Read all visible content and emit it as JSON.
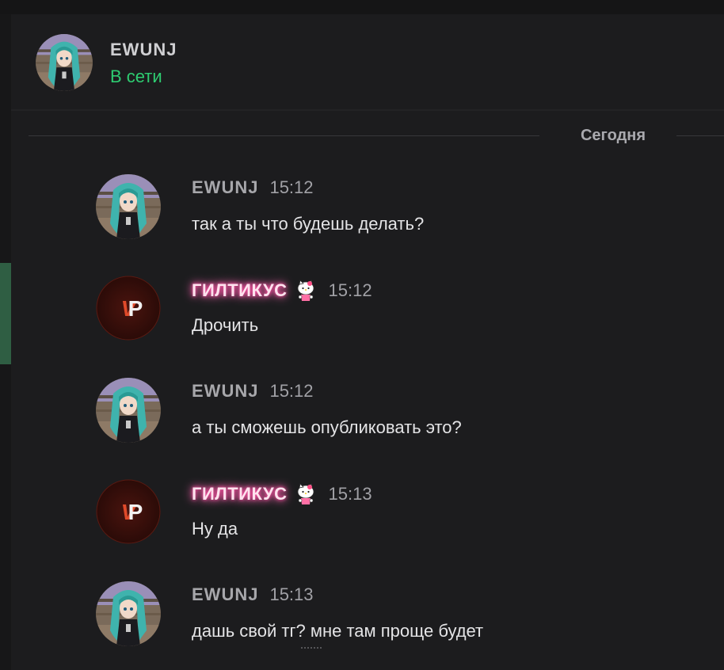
{
  "header": {
    "name": "EWUNJ",
    "status": "В сети"
  },
  "divider": {
    "label": "Сегодня"
  },
  "messages": [
    {
      "author": "EWUNJ",
      "time": "15:12",
      "text": "так а ты что будешь делать?",
      "avatar": "anime-avatar",
      "styled": false
    },
    {
      "author": "ГИЛТИКУС",
      "time": "15:12",
      "text": "Дрочить",
      "avatar": "vp-logo-avatar",
      "styled": true,
      "badge": "hello-kitty-icon"
    },
    {
      "author": "EWUNJ",
      "time": "15:12",
      "text": "а ты сможешь опубликовать это?",
      "avatar": "anime-avatar",
      "styled": false
    },
    {
      "author": "ГИЛТИКУС",
      "time": "15:13",
      "text": "Ну да",
      "avatar": "vp-logo-avatar",
      "styled": true,
      "badge": "hello-kitty-icon"
    },
    {
      "author": "EWUNJ",
      "time": "15:13",
      "text": "дашь свой тг? мне там проще будет",
      "avatar": "anime-avatar",
      "styled": false
    }
  ],
  "colors": {
    "online": "#2ecc71",
    "background": "#1c1c1e",
    "glow": "#ff4fa3",
    "vp_red": "#e04a2a"
  }
}
